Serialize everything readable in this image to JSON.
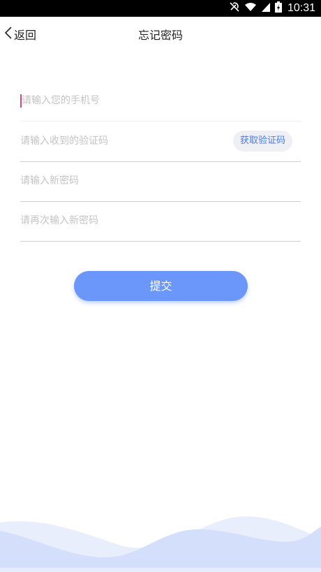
{
  "status_bar": {
    "time": "10:31",
    "icons": [
      "mute-icon",
      "wifi-icon",
      "signal-icon",
      "battery-icon"
    ]
  },
  "nav": {
    "back_label": "返回",
    "title": "忘记密码"
  },
  "form": {
    "phone": {
      "placeholder": "请输入您的手机号",
      "value": ""
    },
    "code": {
      "placeholder": "请输入收到的验证码",
      "value": ""
    },
    "get_code_label": "获取验证码",
    "new_password": {
      "placeholder": "请输入新密码",
      "value": ""
    },
    "confirm_password": {
      "placeholder": "请再次输入新密码",
      "value": ""
    }
  },
  "submit_label": "提交",
  "colors": {
    "accent": "#6b97fa",
    "link": "#4a7be8",
    "cursor": "#e0417a",
    "wave_light": "#e8eefc",
    "wave_mid": "#d4e0fb"
  }
}
